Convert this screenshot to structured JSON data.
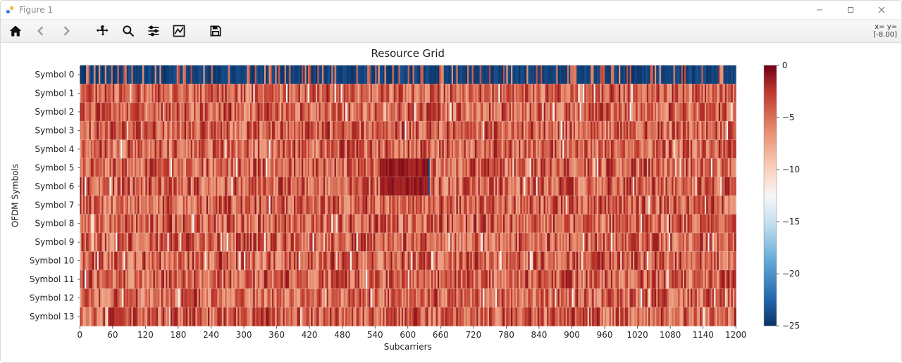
{
  "window": {
    "title": "Figure 1"
  },
  "toolbar": {
    "coord_line1": "x= y=",
    "coord_line2": "[-8.00]"
  },
  "chart_data": {
    "type": "heatmap",
    "title": "Resource Grid",
    "xlabel": "Subcarriers",
    "ylabel": "OFDM Symbols",
    "x_ticks": [
      0,
      60,
      120,
      180,
      240,
      300,
      360,
      420,
      480,
      540,
      600,
      660,
      720,
      780,
      840,
      900,
      960,
      1020,
      1080,
      1140,
      1200
    ],
    "y_tick_labels": [
      "Symbol 0",
      "Symbol 1",
      "Symbol 2",
      "Symbol 3",
      "Symbol 4",
      "Symbol 5",
      "Symbol 6",
      "Symbol 7",
      "Symbol 8",
      "Symbol 9",
      "Symbol 10",
      "Symbol 11",
      "Symbol 12",
      "Symbol 13"
    ],
    "x_range": [
      0,
      1200
    ],
    "n_symbols": 14,
    "colorbar": {
      "ticks": [
        0,
        -5,
        -10,
        -15,
        -20,
        -25
      ],
      "range": [
        -25,
        0
      ]
    },
    "colormap": "RdBu_r",
    "notes": {
      "symbol0": "Row 0 (Symbol 0) is dominated by values near -25 (deep blue) with scattered red stripes.",
      "central_block": "A roughly uniform dark-red block (~value 0) spans approximately subcarriers 550–640 on Symbol 5 and Symbol 6, with a thin blue column near subcarrier 640.",
      "background": "All other cells are random red-ish values roughly in [-8, 0]."
    }
  }
}
